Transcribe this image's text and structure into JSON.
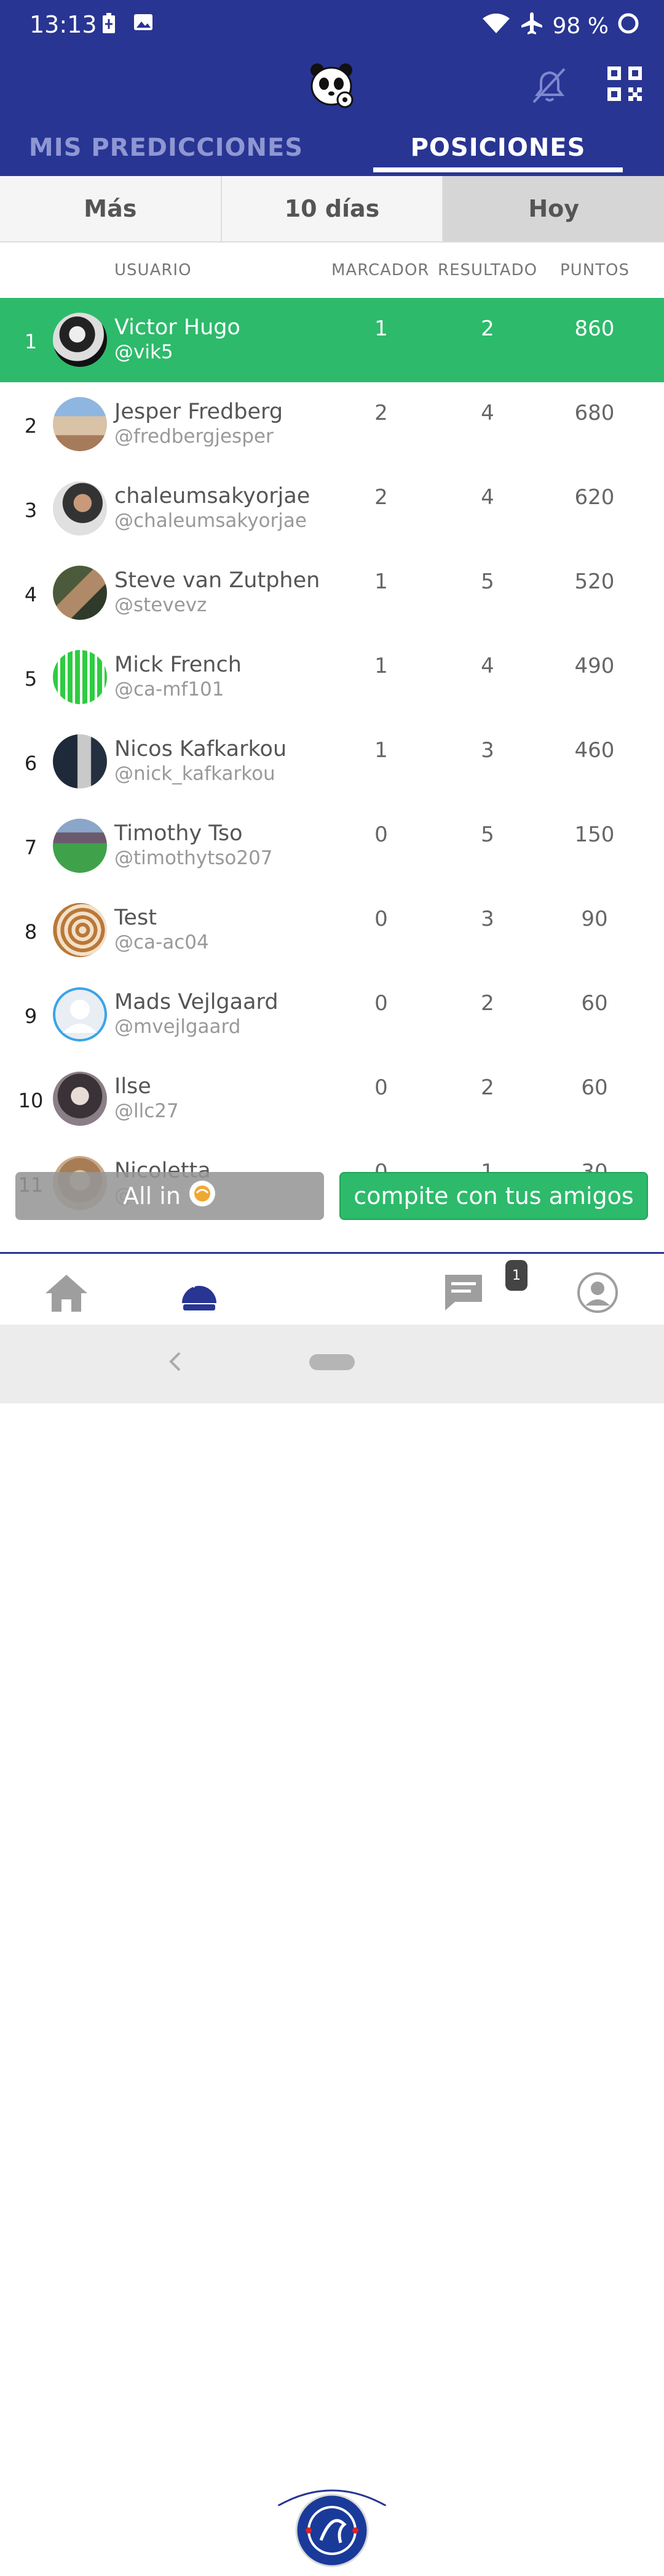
{
  "status_bar": {
    "time": "13:13",
    "battery": "98 %"
  },
  "tabs": [
    {
      "label": "MIS PREDICCIONES"
    },
    {
      "label": "POSICIONES"
    }
  ],
  "filters": [
    {
      "label": "Más"
    },
    {
      "label": "10 días"
    },
    {
      "label": "Hoy"
    }
  ],
  "columns": {
    "user": "USUARIO",
    "marcador": "MARCADOR",
    "resultado": "RESULTADO",
    "puntos": "PUNTOS"
  },
  "rows": [
    {
      "rank": "1",
      "name": "Victor Hugo",
      "handle": "@vik5",
      "marcador": "1",
      "resultado": "2",
      "puntos": "860"
    },
    {
      "rank": "2",
      "name": "Jesper Fredberg",
      "handle": "@fredbergjesper",
      "marcador": "2",
      "resultado": "4",
      "puntos": "680"
    },
    {
      "rank": "3",
      "name": "chaleumsakyorjae",
      "handle": "@chaleumsakyorjae",
      "marcador": "2",
      "resultado": "4",
      "puntos": "620"
    },
    {
      "rank": "4",
      "name": "Steve van Zutphen",
      "handle": "@stevevz",
      "marcador": "1",
      "resultado": "5",
      "puntos": "520"
    },
    {
      "rank": "5",
      "name": "Mick French",
      "handle": "@ca-mf101",
      "marcador": "1",
      "resultado": "4",
      "puntos": "490"
    },
    {
      "rank": "6",
      "name": "Nicos Kafkarkou",
      "handle": "@nick_kafkarkou",
      "marcador": "1",
      "resultado": "3",
      "puntos": "460"
    },
    {
      "rank": "7",
      "name": "Timothy Tso",
      "handle": "@timothytso207",
      "marcador": "0",
      "resultado": "5",
      "puntos": "150"
    },
    {
      "rank": "8",
      "name": "Test",
      "handle": "@ca-ac04",
      "marcador": "0",
      "resultado": "3",
      "puntos": "90"
    },
    {
      "rank": "9",
      "name": "Mads Vejlgaard",
      "handle": "@mvejlgaard",
      "marcador": "0",
      "resultado": "2",
      "puntos": "60"
    },
    {
      "rank": "10",
      "name": "Ilse",
      "handle": "@llc27",
      "marcador": "0",
      "resultado": "2",
      "puntos": "60"
    },
    {
      "rank": "11",
      "name": "Nicoletta",
      "handle": "@",
      "marcador": "0",
      "resultado": "1",
      "puntos": "30"
    }
  ],
  "actions": {
    "all_in": "All in",
    "compite": "compite con tus amigos"
  },
  "bottom_nav": {
    "messages_badge": "1"
  },
  "colors": {
    "header": "#283593",
    "accent_green": "#2dba6b",
    "tab_inactive": "#8f97d3"
  },
  "icons": [
    "battery-icon",
    "image-icon",
    "wifi-icon",
    "airplane-icon",
    "circle-icon",
    "panda-logo-icon",
    "bell-off-icon",
    "qr-icon",
    "home-icon",
    "crystal-ball-icon",
    "chat-icon",
    "profile-icon",
    "chelsea-crest-icon",
    "back-icon",
    "home-pill-icon"
  ]
}
